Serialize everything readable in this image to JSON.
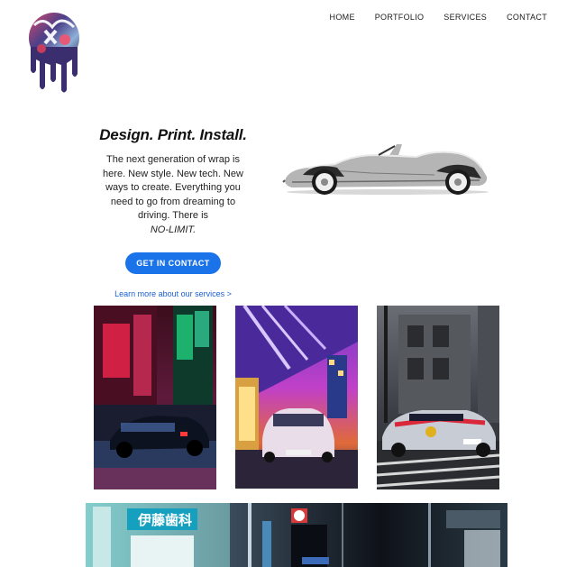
{
  "nav": {
    "items": [
      {
        "label": "HOME"
      },
      {
        "label": "PORTFOLIO"
      },
      {
        "label": "SERVICES"
      },
      {
        "label": "CONTACT"
      }
    ]
  },
  "hero": {
    "headline": "Design. Print. Install.",
    "body": "The next generation of wrap is here. New style. New tech. New ways to create. Everything you need to go from dreaming to driving. There is",
    "body_emphasis": "NO-LIMIT.",
    "cta_label": "GET IN CONTACT",
    "learn_link": "Learn more about our services >"
  },
  "colors": {
    "accent": "#1a73e8",
    "link": "#1a5fd0",
    "text": "#1a1a1a"
  },
  "icons": {
    "logo": "dripping-skull-logo-icon"
  },
  "gallery": {
    "images": [
      {
        "name": "neon-street-car-photo"
      },
      {
        "name": "overpass-purple-car-photo"
      },
      {
        "name": "redbull-drift-car-photo"
      },
      {
        "name": "street-storefront-photo"
      }
    ],
    "sign_text": "伊藤歯科"
  }
}
